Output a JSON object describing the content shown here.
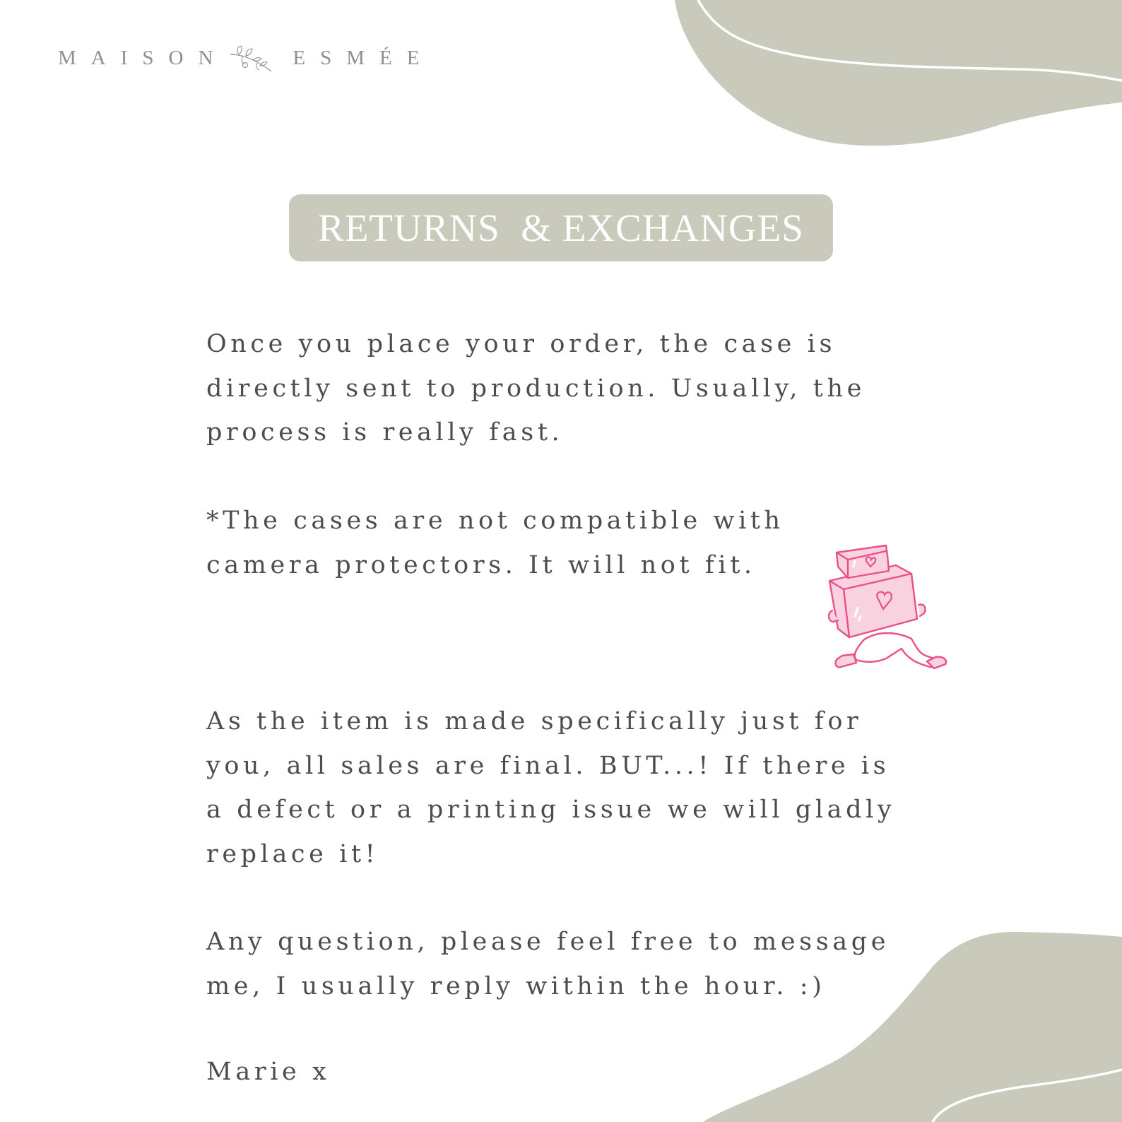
{
  "brand": {
    "left_word": "MAISON",
    "right_word": "ESMÉE",
    "logo_icon": "olive-branch-icon"
  },
  "title": "RETURNS  & EXCHANGES",
  "paragraphs": {
    "production": "Once you place your order, the case is\ndirectly sent to production. Usually, the\nprocess is really fast.",
    "compatibility": "*The cases are not compatible with\ncamera protectors. It will not fit.",
    "final_sales": "As the item is made specifically just for\nyou, all sales are final. BUT...! If there is\na defect or a printing issue we will gladly\nreplace it!",
    "questions": "Any question, please feel free to message\nme, I usually reply within the hour. :)",
    "signoff": "Marie x"
  },
  "illustration": {
    "icon": "courier-carrying-heart-boxes-icon"
  },
  "colors": {
    "sage": "#c9cabb",
    "text": "#4d4d4d",
    "brand_text": "#8f9088",
    "illustration_pink": "#e94f8a",
    "illustration_fill": "#f9d2e0",
    "background": "#ffffff"
  }
}
